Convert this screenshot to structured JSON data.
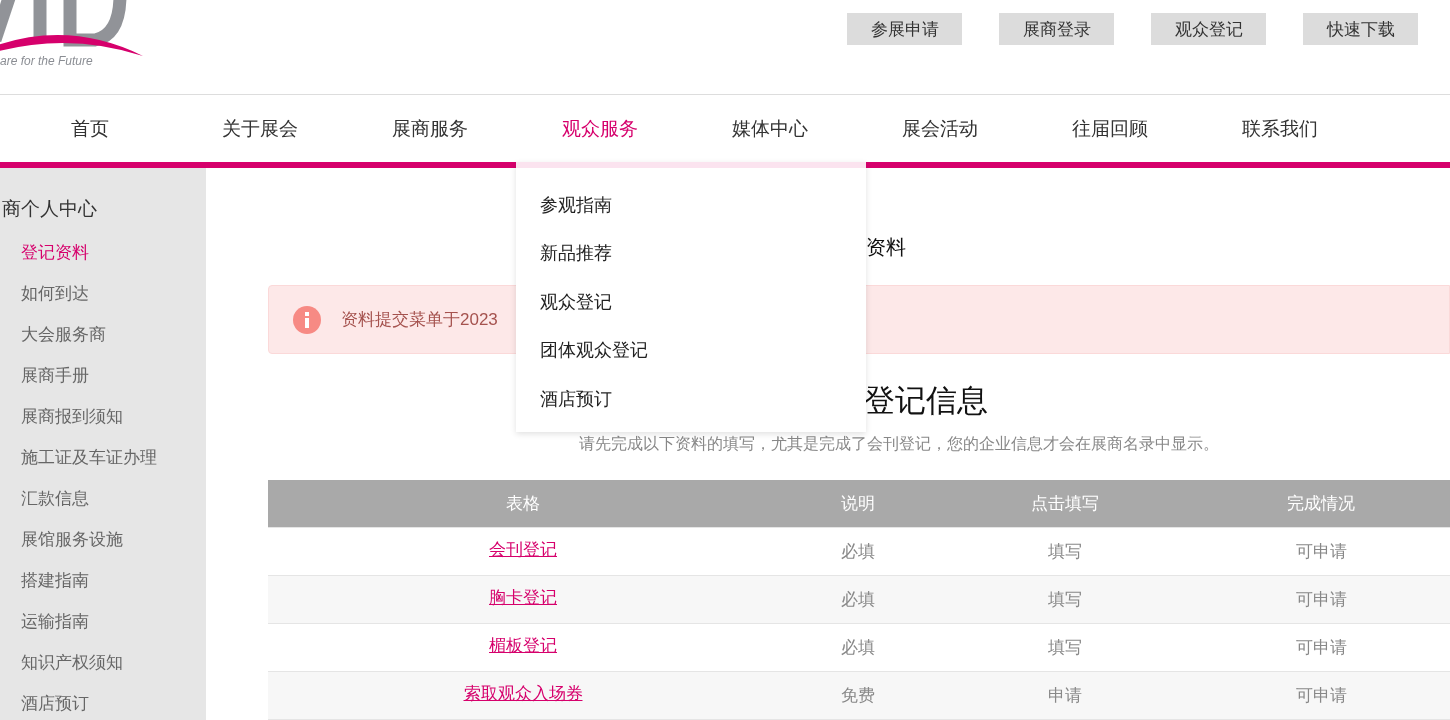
{
  "logo": {
    "tagline": "are for the Future"
  },
  "top_buttons": [
    "参展申请",
    "展商登录",
    "观众登记",
    "快速下载"
  ],
  "nav": [
    {
      "label": "首页",
      "selected": false
    },
    {
      "label": "关于展会",
      "selected": false
    },
    {
      "label": "展商服务",
      "selected": false
    },
    {
      "label": "观众服务",
      "selected": true
    },
    {
      "label": "媒体中心",
      "selected": false
    },
    {
      "label": "展会活动",
      "selected": false
    },
    {
      "label": "往届回顾",
      "selected": false
    },
    {
      "label": "联系我们",
      "selected": false
    }
  ],
  "dropdown": [
    "参观指南",
    "新品推荐",
    "观众登记",
    "团体观众登记",
    "酒店预订"
  ],
  "sidebar": {
    "title": "商个人中心",
    "items": [
      {
        "label": "登记资料",
        "selected": true
      },
      {
        "label": "如何到达",
        "selected": false
      },
      {
        "label": "大会服务商",
        "selected": false
      },
      {
        "label": "展商手册",
        "selected": false
      },
      {
        "label": "展商报到须知",
        "selected": false
      },
      {
        "label": "施工证及车证办理",
        "selected": false
      },
      {
        "label": "汇款信息",
        "selected": false
      },
      {
        "label": "展馆服务设施",
        "selected": false
      },
      {
        "label": "搭建指南",
        "selected": false
      },
      {
        "label": "运输指南",
        "selected": false
      },
      {
        "label": "知识产权须知",
        "selected": false
      },
      {
        "label": "酒店预订",
        "selected": false
      }
    ]
  },
  "page_title": "资料",
  "alert": "资料提交菜单于2023",
  "step": {
    "title": "登记信息",
    "note": "请先完成以下资料的填写，尤其是完成了会刊登记，您的企业信息才会在展商名录中显示。"
  },
  "table": {
    "columns": [
      "表格",
      "说明",
      "点击填写",
      "完成情况"
    ],
    "rows": [
      [
        "会刊登记",
        "必填",
        "填写",
        "可申请"
      ],
      [
        "胸卡登记",
        "必填",
        "填写",
        "可申请"
      ],
      [
        "楣板登记",
        "必填",
        "填写",
        "可申请"
      ],
      [
        "索取观众入场券",
        "免费",
        "申请",
        "可申请"
      ]
    ]
  }
}
